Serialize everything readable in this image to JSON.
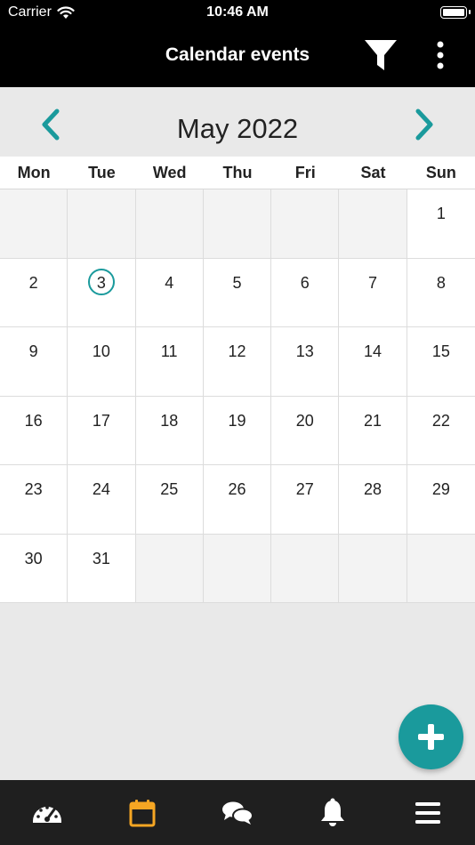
{
  "status_bar": {
    "carrier": "Carrier",
    "time": "10:46 AM",
    "battery_level": 1.0
  },
  "header": {
    "title": "Calendar events",
    "filter_icon": "filter-icon",
    "more_icon": "more-vertical-icon"
  },
  "calendar": {
    "month_label": "May 2022",
    "prev_icon": "chevron-left-icon",
    "next_icon": "chevron-right-icon",
    "weekdays": [
      "Mon",
      "Tue",
      "Wed",
      "Thu",
      "Fri",
      "Sat",
      "Sun"
    ],
    "days": [
      "",
      "",
      "",
      "",
      "",
      "",
      "1",
      "2",
      "3",
      "4",
      "5",
      "6",
      "7",
      "8",
      "9",
      "10",
      "11",
      "12",
      "13",
      "14",
      "15",
      "16",
      "17",
      "18",
      "19",
      "20",
      "21",
      "22",
      "23",
      "24",
      "25",
      "26",
      "27",
      "28",
      "29",
      "30",
      "31",
      "",
      "",
      "",
      "",
      ""
    ],
    "today": "3"
  },
  "fab": {
    "icon": "plus-icon"
  },
  "tabs": [
    {
      "icon": "dashboard-gauge-icon",
      "active": false
    },
    {
      "icon": "calendar-icon",
      "active": true
    },
    {
      "icon": "chat-bubbles-icon",
      "active": false
    },
    {
      "icon": "bell-icon",
      "active": false
    },
    {
      "icon": "menu-icon",
      "active": false
    }
  ],
  "colors": {
    "accent": "#1a9a9c",
    "active_tab": "#f5a623",
    "header_bg": "#000000",
    "tabbar_bg": "#1f1f1f"
  }
}
